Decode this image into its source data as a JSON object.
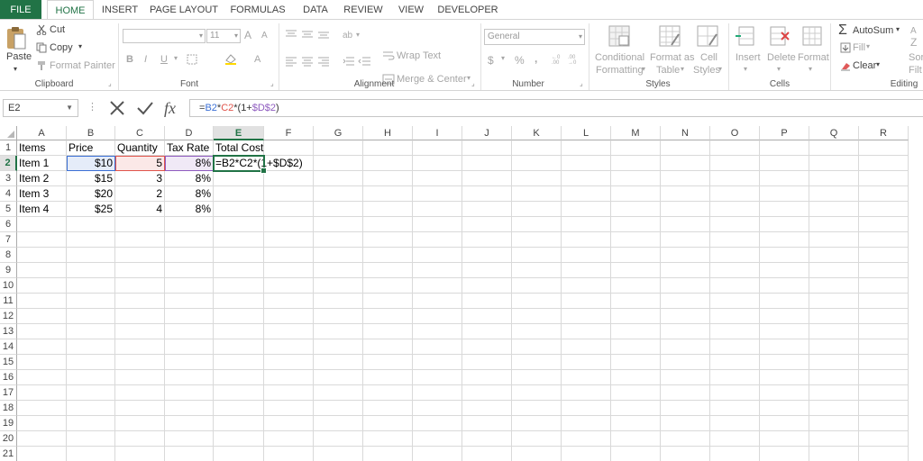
{
  "tabs": [
    "FILE",
    "HOME",
    "INSERT",
    "PAGE LAYOUT",
    "FORMULAS",
    "DATA",
    "REVIEW",
    "VIEW",
    "DEVELOPER"
  ],
  "ribbon": {
    "clipboard": {
      "paste": "Paste",
      "cut": "Cut",
      "copy": "Copy",
      "format_painter": "Format Painter",
      "label": "Clipboard"
    },
    "font": {
      "size": "11",
      "bold": "B",
      "italic": "I",
      "underline": "U",
      "grow": "A",
      "shrink": "A",
      "font_color": "A",
      "label": "Font"
    },
    "alignment": {
      "wrap_text": "Wrap Text",
      "merge_center": "Merge & Center",
      "label": "Alignment"
    },
    "number": {
      "format": "General",
      "currency": "$",
      "percent": "%",
      "comma": ",",
      "label": "Number"
    },
    "styles": {
      "conditional": "Conditional",
      "formatting": "Formatting",
      "format_as": "Format as",
      "table": "Table",
      "cell": "Cell",
      "styles_word": "Styles",
      "label": "Styles"
    },
    "cells": {
      "insert": "Insert",
      "delete": "Delete",
      "format": "Format",
      "label": "Cells"
    },
    "editing": {
      "autosum": "AutoSum",
      "fill": "Fill",
      "clear": "Clear",
      "sort": "Sor",
      "filter": "Filt",
      "label": "Editing"
    }
  },
  "formula_bar": {
    "name_box": "E2",
    "formula_parts": [
      {
        "text": "=",
        "color": "#333333"
      },
      {
        "text": "B2",
        "color": "#3b6fd4"
      },
      {
        "text": "*",
        "color": "#333333"
      },
      {
        "text": "C2",
        "color": "#e0544b"
      },
      {
        "text": "*(1+",
        "color": "#333333"
      },
      {
        "text": "$D$2",
        "color": "#8e5bbf"
      },
      {
        "text": ")",
        "color": "#333333"
      }
    ],
    "cancel_icon": "x-icon",
    "enter_icon": "check-icon",
    "fx": "fx"
  },
  "grid": {
    "columns": [
      "A",
      "B",
      "C",
      "D",
      "E",
      "F",
      "G",
      "H",
      "I",
      "J",
      "K",
      "L",
      "M",
      "N",
      "O",
      "P",
      "Q",
      "R"
    ],
    "rows": [
      "1",
      "2",
      "3",
      "4",
      "5",
      "6",
      "7",
      "8",
      "9",
      "10",
      "11",
      "12",
      "13",
      "14",
      "15",
      "16",
      "17",
      "18",
      "19",
      "20",
      "21"
    ],
    "selected_cell": "E2",
    "cells": {
      "A1": "Items",
      "B1": "Price",
      "C1": "Quantity",
      "D1": "Tax Rate",
      "E1": "Total Cost",
      "A2": "Item 1",
      "B2": "$10",
      "C2": "5",
      "D2": "8%",
      "E2": "=B2*C2*(1+$D$2)",
      "A3": "Item 2",
      "B3": "$15",
      "C3": "3",
      "D3": "8%",
      "A4": "Item 3",
      "B4": "$20",
      "C4": "2",
      "D4": "8%",
      "A5": "Item 4",
      "B5": "$25",
      "C5": "4",
      "D5": "8%"
    },
    "ref_colors": {
      "B2": "#3b6fd4",
      "C2": "#e0544b",
      "D2": "#8e5bbf",
      "E2": "#217346"
    }
  }
}
